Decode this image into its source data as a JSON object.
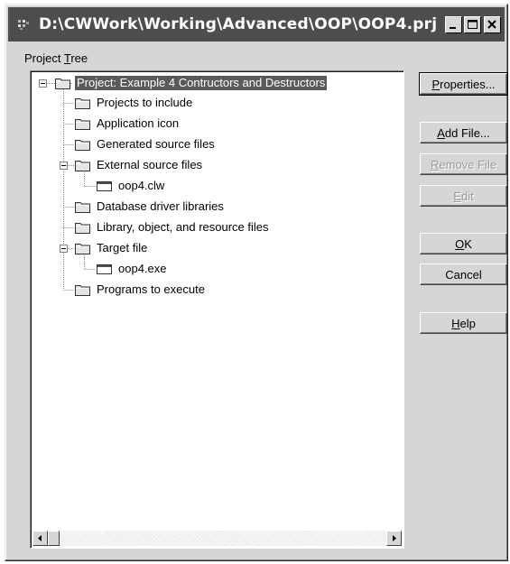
{
  "window": {
    "title": "D:\\CWWork\\Working\\Advanced\\OOP\\OOP4.prj"
  },
  "tree_label": {
    "pre": "Project ",
    "accel": "T",
    "post": "ree"
  },
  "tree": {
    "root": "Project: Example 4 Contructors and Destructors",
    "items": [
      "Projects to include",
      "Application icon",
      "Generated source files",
      "External source files",
      "oop4.clw",
      "Database driver libraries",
      "Library, object, and resource files",
      "Target file",
      "oop4.exe",
      "Programs to execute"
    ]
  },
  "buttons": {
    "properties": {
      "accel": "P",
      "rest": "roperties..."
    },
    "add_file": {
      "accel": "A",
      "rest": "dd File..."
    },
    "remove_file": {
      "accel": "R",
      "rest": "emove File"
    },
    "edit": {
      "accel": "E",
      "rest": "dit"
    },
    "ok": {
      "accel": "O",
      "rest": "K"
    },
    "cancel": {
      "label": "Cancel"
    },
    "help": {
      "accel": "H",
      "rest": "elp"
    }
  },
  "colors": {
    "titlebar": "#4d4d4d",
    "dialog_face": "#d6d6d6",
    "selection": "#5a5a5a"
  }
}
